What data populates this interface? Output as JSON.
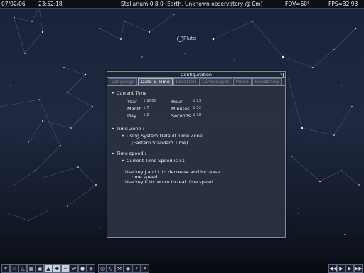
{
  "topbar": {
    "date": "07/02/06",
    "time": "23:52:18",
    "title": "Stellarium 0.8.0 (Earth, Unknown observatory @ 0m)",
    "fov": "FOV=60°",
    "fps": "FPS=32.93"
  },
  "sky": {
    "pluto_label": "Pluto"
  },
  "dialog": {
    "title": "Configuration",
    "close_label": "x",
    "tabs": [
      "Language",
      "Date & Time",
      "Location",
      "Landscapes",
      "Video",
      "Rendering"
    ],
    "active_tab": "Date & Time",
    "current_time": {
      "heading": "Current Time :",
      "year_label": "Year",
      "year_value": "2006",
      "month_label": "Month",
      "month_value": "7",
      "day_label": "Day",
      "day_value": "2",
      "hour_label": "Hour",
      "hour_value": "23",
      "minutes_label": "Minutes",
      "minutes_value": "52",
      "seconds_label": "Seconds",
      "seconds_value": "18"
    },
    "time_zone": {
      "heading": "Time Zone :",
      "option": "Using System Default Time Zone",
      "detail": "(Eastern Standard Time)"
    },
    "time_speed": {
      "heading": "Time speed :",
      "current": "Current Time Speed is x1",
      "help1": "Use key J and L to decrease and increase",
      "help2": "time speed.",
      "help3": "Use key K to return to real time speed."
    }
  },
  "toolbar": {
    "left_icons": [
      "constellation-lines-icon",
      "constellation-names-icon",
      "constellation-art-icon",
      "azimuth-grid-icon",
      "equatorial-grid-icon",
      "ground-icon",
      "cardinal-points-icon",
      "atmosphere-icon",
      "nebula-names-icon",
      "planet-names-icon",
      "equatorial-mount-icon",
      "goto-icon",
      "search-icon",
      "tools-icon",
      "night-mode-icon",
      "help-icon",
      "quit-icon"
    ],
    "right_icons": [
      "rewind-icon",
      "play-icon",
      "realtime-icon",
      "fast-forward-icon"
    ]
  }
}
